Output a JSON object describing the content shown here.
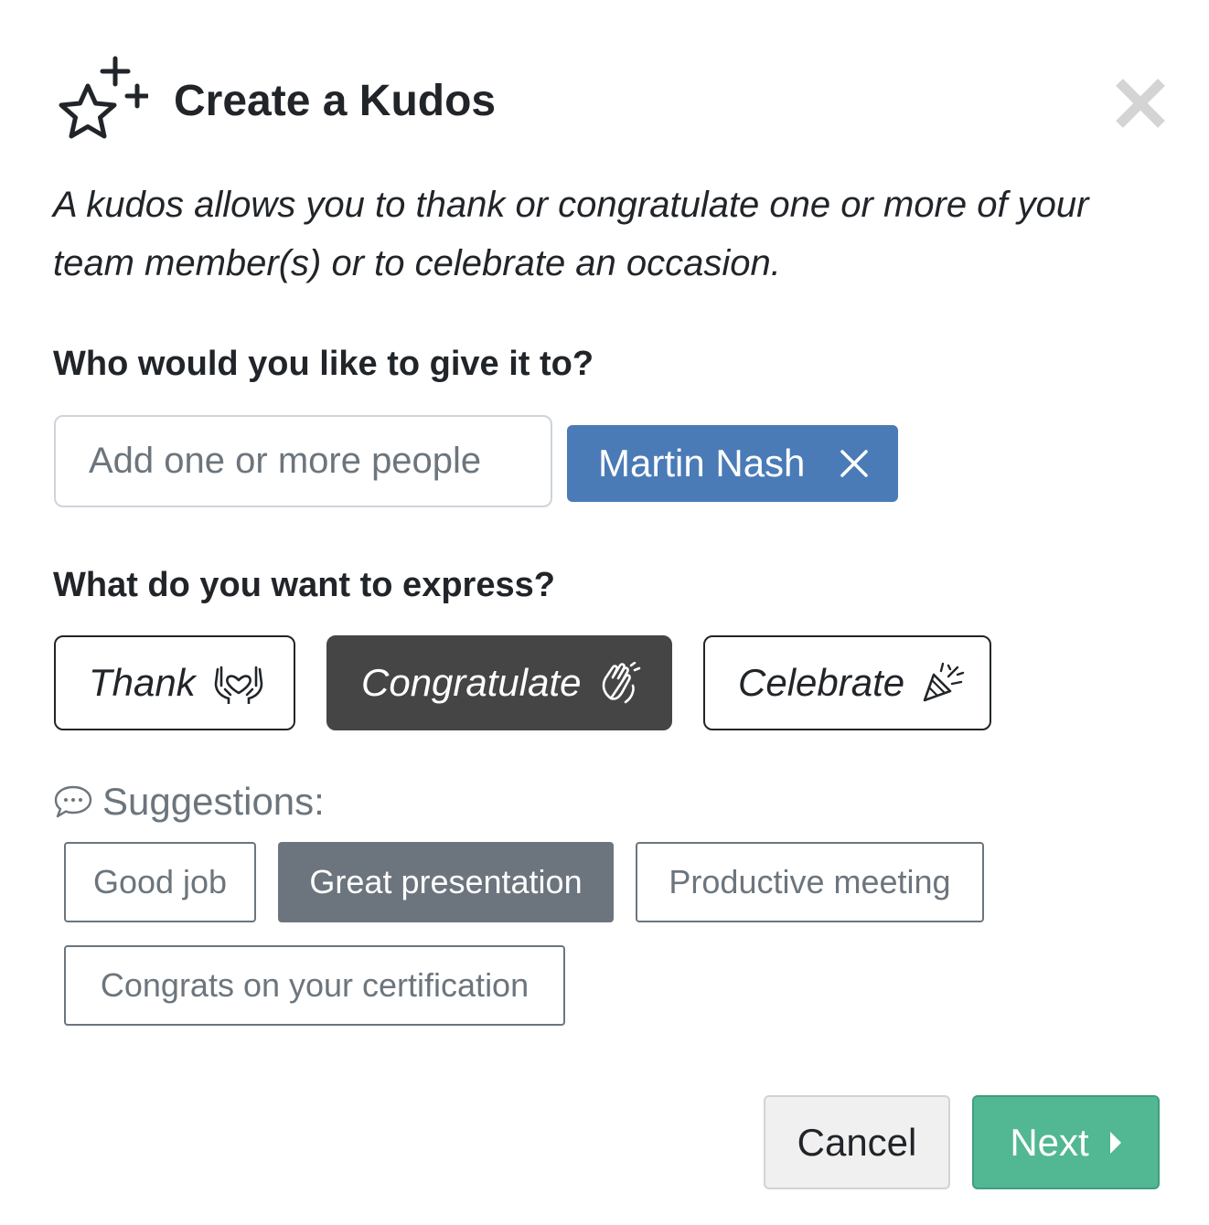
{
  "dialog": {
    "title": "Create a Kudos",
    "title_icon": "star-sparkle-icon",
    "close_icon": "close-icon",
    "description": "A kudos allows you to thank or congratulate one or more of your team member(s) or to celebrate an occasion."
  },
  "recipients": {
    "label": "Who would you like to give it to?",
    "input_placeholder": "Add one or more people",
    "input_value": "",
    "selected": [
      {
        "name": "Martin Nash",
        "remove_icon": "remove-x-icon"
      }
    ]
  },
  "express": {
    "label": "What do you want to express?",
    "options": [
      {
        "label": "Thank",
        "icon": "hands-heart-icon",
        "selected": false
      },
      {
        "label": "Congratulate",
        "icon": "clapping-hands-icon",
        "selected": true
      },
      {
        "label": "Celebrate",
        "icon": "party-popper-icon",
        "selected": false
      }
    ]
  },
  "suggestions": {
    "label": "Suggestions:",
    "icon": "speech-bubble-icon",
    "items": [
      {
        "label": "Good job",
        "selected": false
      },
      {
        "label": "Great presentation",
        "selected": true
      },
      {
        "label": "Productive meeting",
        "selected": false
      },
      {
        "label": "Congrats on your certification",
        "selected": false
      }
    ]
  },
  "footer": {
    "cancel_label": "Cancel",
    "next_label": "Next",
    "next_icon": "caret-right-icon"
  },
  "colors": {
    "chip_blue": "#4a7bb7",
    "active_dark": "#454545",
    "suggestion_gray": "#6c757d",
    "next_green": "#52b793"
  }
}
